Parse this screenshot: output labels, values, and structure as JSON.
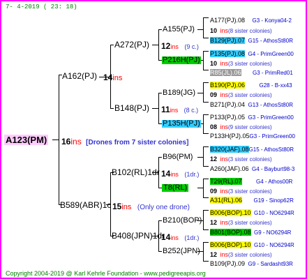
{
  "header": {
    "date": "7-  4-2019 ( 23: 18)"
  },
  "footer": {
    "copyright": "Copyright 2004-2019 @ Karl Kehrle Foundation",
    "url": "www.pedigreeapis.org"
  },
  "root": {
    "name": "A123(PM)",
    "ins": "16",
    "ins_label": "ins",
    "note": "[Drones from 7 sister colonies]"
  },
  "g1": [
    {
      "name": "A162(PJ)",
      "ins": "14",
      "ins_label": "ins"
    },
    {
      "name": "B589(ABR)1c",
      "ins": "15",
      "ins_label": "ins",
      "note": "(Only one drone)"
    }
  ],
  "g2": [
    {
      "name": "A272(PJ)",
      "ins": "12",
      "ins_label": "ins",
      "note": "(9 c.)"
    },
    {
      "name": "B148(PJ)",
      "ins": "11",
      "ins_label": "ins",
      "note": "(8 c.)"
    },
    {
      "name": "B102(RL)1dr",
      "ins": "14",
      "ins_label": "ins",
      "note": "(1dr.)"
    },
    {
      "name": "B408(JPN)1dr",
      "ins": "14",
      "ins_label": "ins",
      "note": "(1dr.)"
    }
  ],
  "g3": [
    {
      "name": "A155(PJ)"
    },
    {
      "name": "P216H(PJ)"
    },
    {
      "name": "B189(JG)"
    },
    {
      "name": "P135H(PJ)"
    },
    {
      "name": "B96(PM)"
    },
    {
      "name": "T8(RL)"
    },
    {
      "name": "B210(BOP)"
    },
    {
      "name": "B252(JPN)"
    }
  ],
  "g4": [
    {
      "name": "A177(PJ).08",
      "loc": "G3 - Konya04-2"
    },
    {
      "ins": "10",
      "ins_label": "ins",
      "note": "(8 sister colonies)"
    },
    {
      "name": "B129(PJ).07",
      "loc": "G15 - AthosSt80R"
    },
    {
      "name": "P135(PJ).08",
      "loc": "G4 - PrimGreen00"
    },
    {
      "ins": "10",
      "ins_label": "ins",
      "note": "(3 sister colonies)"
    },
    {
      "name": "R85(JL).06",
      "loc": "G3 - PrimRed01"
    },
    {
      "name": "B190(PJ).06",
      "loc": "G28 - B-xx43"
    },
    {
      "ins": "09",
      "ins_label": "ins",
      "note": "(3 sister colonies)"
    },
    {
      "name": "B271(PJ).04",
      "loc": "G13 - AthosSt80R"
    },
    {
      "name": "P133(PJ).05",
      "loc": "G3 - PrimGreen00"
    },
    {
      "ins": "08",
      "ins_label": "ins",
      "note": "(9 sister colonies)"
    },
    {
      "name": "P133H(PJ).05",
      "loc": "G3 - PrimGreen00"
    },
    {
      "name": "B320(JAF).08",
      "loc": "G15 - AthosSt80R"
    },
    {
      "ins": "12",
      "ins_label": "ins",
      "note": "(3 sister colonies)"
    },
    {
      "name": "A260(JAF).06",
      "loc": "G4 - Bayburt98-3"
    },
    {
      "name": "T29(RL).07",
      "loc": "G4 - Athos00R"
    },
    {
      "ins": "09",
      "ins_label": "ins",
      "note": "(3 sister colonies)"
    },
    {
      "name": "A31(RL).06",
      "loc": "G19 - Sinop62R"
    },
    {
      "name": "B006(BOP).10",
      "loc": "G10 - NO6294R"
    },
    {
      "ins": "12",
      "ins_label": "ins",
      "note": "(3 sister colonies)"
    },
    {
      "name": "B801(BOP).08",
      "loc": "G9 - NO6294R"
    },
    {
      "name": "B006(BOP).10",
      "loc": "G10 - NO6294R"
    },
    {
      "ins": "12",
      "ins_label": "ins",
      "note": "(3 sister colonies)"
    },
    {
      "name": "B109(PJ).09",
      "loc": "G9 - Sardasht93R"
    }
  ]
}
